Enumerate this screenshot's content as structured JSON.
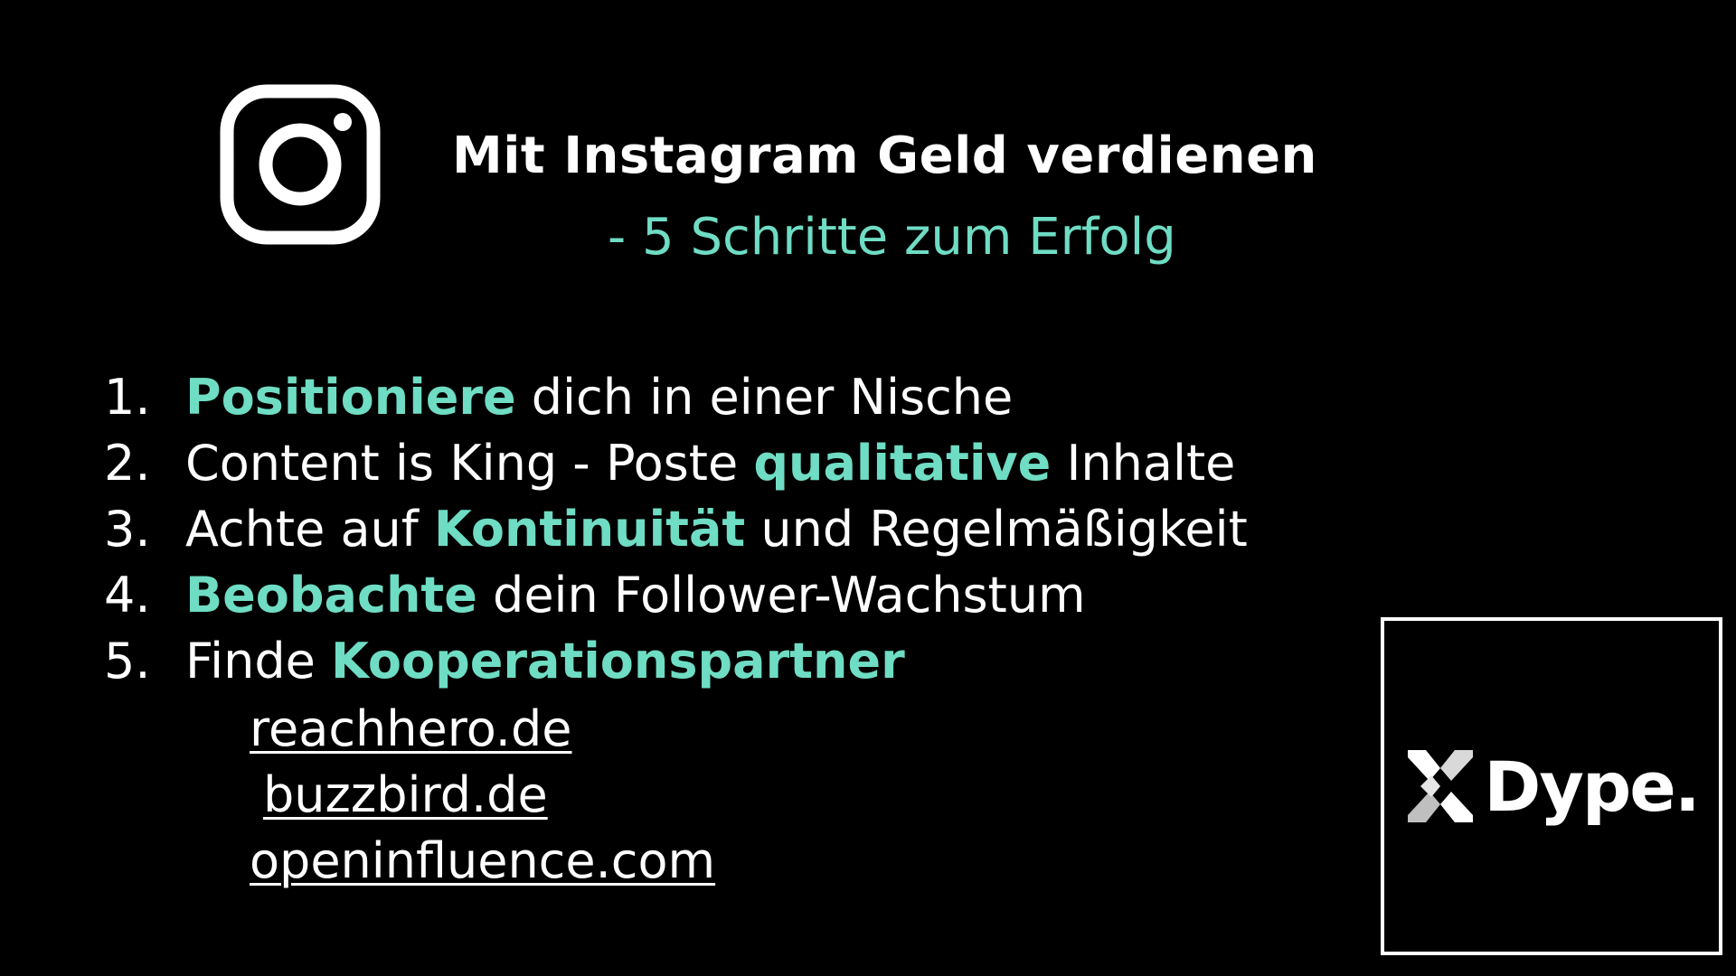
{
  "header": {
    "title": "Mit Instagram Geld verdienen",
    "subtitle": "- 5 Schritte zum Erfolg"
  },
  "colors": {
    "accent": "#6fdcc4",
    "text": "#ffffff",
    "background": "#000000"
  },
  "icons": {
    "instagram": "instagram-icon",
    "brand": "dype-logo-icon"
  },
  "steps": [
    {
      "num": "1.",
      "pre": "",
      "bold": "Positioniere",
      "post": " dich in einer Nische"
    },
    {
      "num": "2.",
      "pre": "Content is King - Poste ",
      "bold": "qualitative",
      "post": " Inhalte"
    },
    {
      "num": "3.",
      "pre": "Achte auf ",
      "bold": "Kontinuität",
      "post": " und Regelmäßigkeit"
    },
    {
      "num": "4.",
      "pre": "",
      "bold": "Beobachte",
      "post": " dein Follower-Wachstum"
    },
    {
      "num": "5.",
      "pre": "Finde ",
      "bold": "Kooperationspartner",
      "post": ""
    }
  ],
  "links": [
    "reachhero.de",
    "buzzbird.de",
    "openinfluence.com"
  ],
  "brand": {
    "name": "Dype."
  }
}
